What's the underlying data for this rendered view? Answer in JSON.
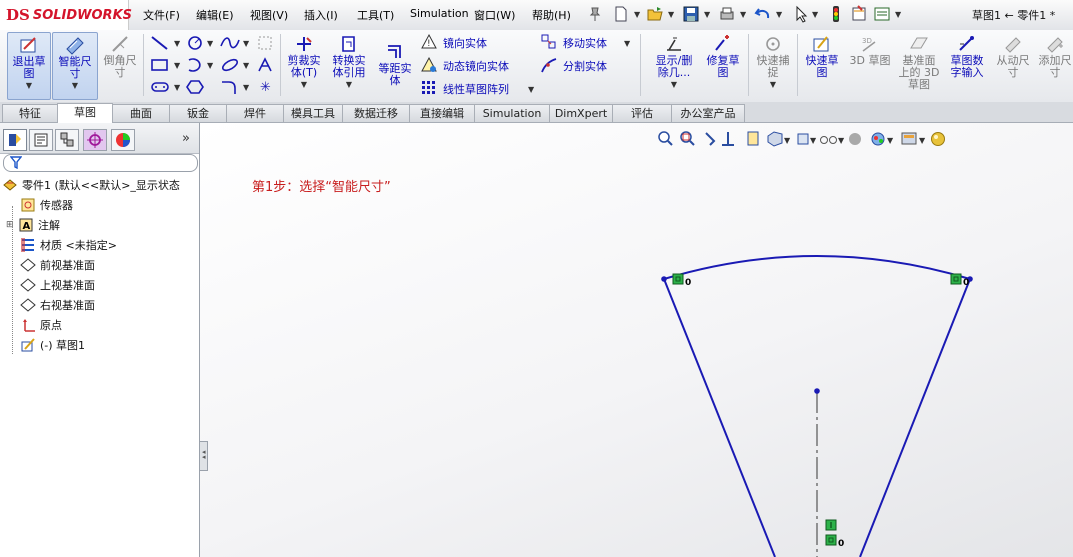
{
  "app": {
    "brand_ds": "DS",
    "brand_name": "SOLIDWORKS"
  },
  "menu": [
    "文件(F)",
    "编辑(E)",
    "视图(V)",
    "插入(I)",
    "工具(T)",
    "Simulation",
    "窗口(W)",
    "帮助(H)"
  ],
  "document_title": "草图1 ← 零件1 *",
  "ribbon": {
    "exit_sketch": "退出草\n图",
    "smart_dimension": "智能尺\n寸",
    "chamfer_dim": "倒角尺\n寸",
    "trim": "剪裁实\n体(T)",
    "convert": "转换实\n体引用",
    "offset": "等距实\n体",
    "mirror": "镜向实体",
    "dynamic_mirror": "动态镜向实体",
    "linear_pattern": "线性草图阵列",
    "move": "移动实体",
    "split": "分割实体",
    "display_delete": "显示/删\n除几...",
    "repair": "修复草\n图",
    "quick_snap": "快速捕\n捉",
    "rapid_sketch": "快速草\n图",
    "sketch_3d": "3D 草图",
    "sketch_3d_plane": "基准面\n上的 3D\n草图",
    "numeric_input": "草图数\n字输入",
    "auto_dim": "从动尺\n寸",
    "add_dim": "添加尺\n寸"
  },
  "tabs": [
    "特征",
    "草图",
    "曲面",
    "钣金",
    "焊件",
    "模具工具",
    "数据迁移",
    "直接编辑",
    "Simulation",
    "DimXpert",
    "评估",
    "办公室产品"
  ],
  "active_tab": "草图",
  "tree": {
    "root": "零件1  (默认<<默认>_显示状态",
    "items": [
      "传感器",
      "注解",
      "材质 <未指定>",
      "前视基准面",
      "上视基准面",
      "右视基准面",
      "原点",
      "(-) 草图1"
    ]
  },
  "hint": "第1步：选择“智能尺寸”",
  "relation_labels": [
    "0",
    "0",
    "0"
  ],
  "colors": {
    "sketch_line": "#1a1ab4",
    "relation": "#2db24a",
    "hint": "#c81e1e"
  }
}
